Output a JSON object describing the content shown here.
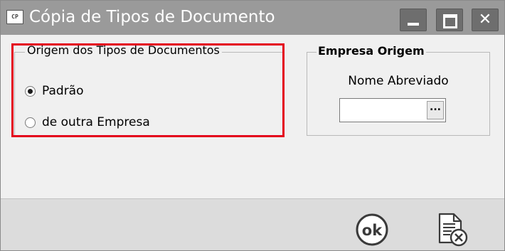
{
  "window": {
    "title": "Cópia de Tipos de Documento",
    "app_icon_text": "CP",
    "controls": {
      "minimize": "minimize-icon",
      "maximize": "maximize-icon",
      "close": "close-icon"
    }
  },
  "origem": {
    "legend": "Origem dos Tipos de Documentos",
    "options": [
      {
        "label": "Padrão",
        "checked": true
      },
      {
        "label": "de outra Empresa",
        "checked": false
      }
    ],
    "highlight_color": "#e4001b"
  },
  "empresa": {
    "legend": "Empresa Origem",
    "field_label": "Nome Abreviado",
    "field_value": "",
    "lookup_button": "..."
  },
  "footer": {
    "ok_icon": "ok-icon",
    "ok_text": "ok",
    "cancel_icon": "cancel-document-icon"
  },
  "colors": {
    "titlebar": "#9a9a9a",
    "titlebar_buttons": "#6e6e6e",
    "content_bg": "#f0f0f0",
    "footer_bg": "#dcdcdc"
  }
}
